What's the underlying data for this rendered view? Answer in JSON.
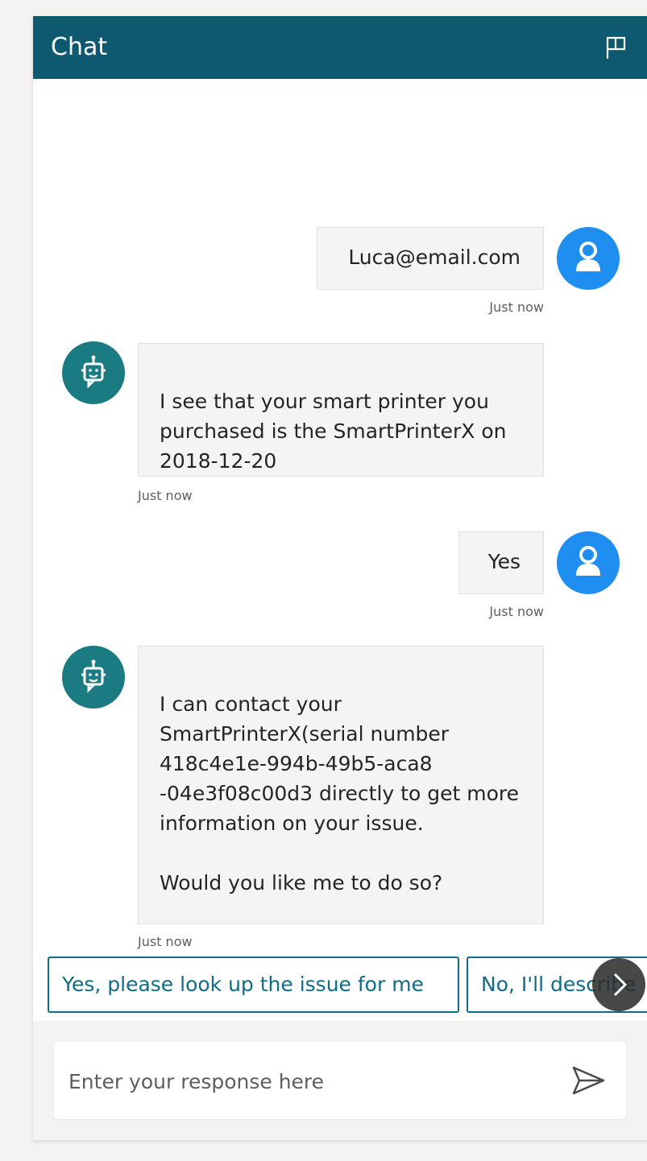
{
  "header": {
    "title": "Chat",
    "flag_icon": "flag-icon",
    "background_color": "#0e5870"
  },
  "messages": [
    {
      "sender": "user",
      "text": "Luca@email.com",
      "timestamp": "Just now",
      "avatar_icon": "user-icon"
    },
    {
      "sender": "bot",
      "text": "I see that your smart printer you purchased is the SmartPrinterX on 2018-12-20",
      "timestamp": "Just now",
      "avatar_icon": "bot-icon"
    },
    {
      "sender": "user",
      "text": "Yes",
      "timestamp": "Just now",
      "avatar_icon": "user-icon"
    },
    {
      "sender": "bot",
      "text": "I can contact your SmartPrinterX(serial number 418c4e1e-994b-49b5-aca8 -04e3f08c00d3 directly to get more information on your issue.\n\nWould you like me to do so?",
      "timestamp": "Just now",
      "avatar_icon": "bot-icon"
    }
  ],
  "suggestions": [
    "Yes, please look up the issue for me",
    "No, I'll describe"
  ],
  "input": {
    "placeholder": "Enter your response here",
    "value": "",
    "send_icon": "send-icon"
  },
  "colors": {
    "user_avatar": "#1f8ef1",
    "bot_avatar": "#1a7c82",
    "accent": "#0e6d86"
  }
}
